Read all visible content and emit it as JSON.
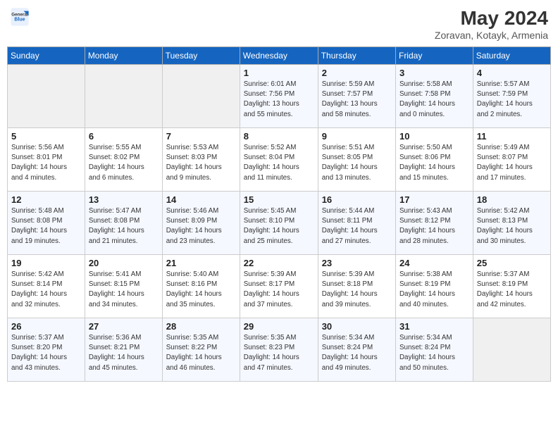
{
  "header": {
    "logo_line1": "General",
    "logo_line2": "Blue",
    "month": "May 2024",
    "location": "Zoravan, Kotayk, Armenia"
  },
  "days_of_week": [
    "Sunday",
    "Monday",
    "Tuesday",
    "Wednesday",
    "Thursday",
    "Friday",
    "Saturday"
  ],
  "weeks": [
    [
      {
        "day": "",
        "info": []
      },
      {
        "day": "",
        "info": []
      },
      {
        "day": "",
        "info": []
      },
      {
        "day": "1",
        "info": [
          "Sunrise: 6:01 AM",
          "Sunset: 7:56 PM",
          "Daylight: 13 hours",
          "and 55 minutes."
        ]
      },
      {
        "day": "2",
        "info": [
          "Sunrise: 5:59 AM",
          "Sunset: 7:57 PM",
          "Daylight: 13 hours",
          "and 58 minutes."
        ]
      },
      {
        "day": "3",
        "info": [
          "Sunrise: 5:58 AM",
          "Sunset: 7:58 PM",
          "Daylight: 14 hours",
          "and 0 minutes."
        ]
      },
      {
        "day": "4",
        "info": [
          "Sunrise: 5:57 AM",
          "Sunset: 7:59 PM",
          "Daylight: 14 hours",
          "and 2 minutes."
        ]
      }
    ],
    [
      {
        "day": "5",
        "info": [
          "Sunrise: 5:56 AM",
          "Sunset: 8:01 PM",
          "Daylight: 14 hours",
          "and 4 minutes."
        ]
      },
      {
        "day": "6",
        "info": [
          "Sunrise: 5:55 AM",
          "Sunset: 8:02 PM",
          "Daylight: 14 hours",
          "and 6 minutes."
        ]
      },
      {
        "day": "7",
        "info": [
          "Sunrise: 5:53 AM",
          "Sunset: 8:03 PM",
          "Daylight: 14 hours",
          "and 9 minutes."
        ]
      },
      {
        "day": "8",
        "info": [
          "Sunrise: 5:52 AM",
          "Sunset: 8:04 PM",
          "Daylight: 14 hours",
          "and 11 minutes."
        ]
      },
      {
        "day": "9",
        "info": [
          "Sunrise: 5:51 AM",
          "Sunset: 8:05 PM",
          "Daylight: 14 hours",
          "and 13 minutes."
        ]
      },
      {
        "day": "10",
        "info": [
          "Sunrise: 5:50 AM",
          "Sunset: 8:06 PM",
          "Daylight: 14 hours",
          "and 15 minutes."
        ]
      },
      {
        "day": "11",
        "info": [
          "Sunrise: 5:49 AM",
          "Sunset: 8:07 PM",
          "Daylight: 14 hours",
          "and 17 minutes."
        ]
      }
    ],
    [
      {
        "day": "12",
        "info": [
          "Sunrise: 5:48 AM",
          "Sunset: 8:08 PM",
          "Daylight: 14 hours",
          "and 19 minutes."
        ]
      },
      {
        "day": "13",
        "info": [
          "Sunrise: 5:47 AM",
          "Sunset: 8:08 PM",
          "Daylight: 14 hours",
          "and 21 minutes."
        ]
      },
      {
        "day": "14",
        "info": [
          "Sunrise: 5:46 AM",
          "Sunset: 8:09 PM",
          "Daylight: 14 hours",
          "and 23 minutes."
        ]
      },
      {
        "day": "15",
        "info": [
          "Sunrise: 5:45 AM",
          "Sunset: 8:10 PM",
          "Daylight: 14 hours",
          "and 25 minutes."
        ]
      },
      {
        "day": "16",
        "info": [
          "Sunrise: 5:44 AM",
          "Sunset: 8:11 PM",
          "Daylight: 14 hours",
          "and 27 minutes."
        ]
      },
      {
        "day": "17",
        "info": [
          "Sunrise: 5:43 AM",
          "Sunset: 8:12 PM",
          "Daylight: 14 hours",
          "and 28 minutes."
        ]
      },
      {
        "day": "18",
        "info": [
          "Sunrise: 5:42 AM",
          "Sunset: 8:13 PM",
          "Daylight: 14 hours",
          "and 30 minutes."
        ]
      }
    ],
    [
      {
        "day": "19",
        "info": [
          "Sunrise: 5:42 AM",
          "Sunset: 8:14 PM",
          "Daylight: 14 hours",
          "and 32 minutes."
        ]
      },
      {
        "day": "20",
        "info": [
          "Sunrise: 5:41 AM",
          "Sunset: 8:15 PM",
          "Daylight: 14 hours",
          "and 34 minutes."
        ]
      },
      {
        "day": "21",
        "info": [
          "Sunrise: 5:40 AM",
          "Sunset: 8:16 PM",
          "Daylight: 14 hours",
          "and 35 minutes."
        ]
      },
      {
        "day": "22",
        "info": [
          "Sunrise: 5:39 AM",
          "Sunset: 8:17 PM",
          "Daylight: 14 hours",
          "and 37 minutes."
        ]
      },
      {
        "day": "23",
        "info": [
          "Sunrise: 5:39 AM",
          "Sunset: 8:18 PM",
          "Daylight: 14 hours",
          "and 39 minutes."
        ]
      },
      {
        "day": "24",
        "info": [
          "Sunrise: 5:38 AM",
          "Sunset: 8:19 PM",
          "Daylight: 14 hours",
          "and 40 minutes."
        ]
      },
      {
        "day": "25",
        "info": [
          "Sunrise: 5:37 AM",
          "Sunset: 8:19 PM",
          "Daylight: 14 hours",
          "and 42 minutes."
        ]
      }
    ],
    [
      {
        "day": "26",
        "info": [
          "Sunrise: 5:37 AM",
          "Sunset: 8:20 PM",
          "Daylight: 14 hours",
          "and 43 minutes."
        ]
      },
      {
        "day": "27",
        "info": [
          "Sunrise: 5:36 AM",
          "Sunset: 8:21 PM",
          "Daylight: 14 hours",
          "and 45 minutes."
        ]
      },
      {
        "day": "28",
        "info": [
          "Sunrise: 5:35 AM",
          "Sunset: 8:22 PM",
          "Daylight: 14 hours",
          "and 46 minutes."
        ]
      },
      {
        "day": "29",
        "info": [
          "Sunrise: 5:35 AM",
          "Sunset: 8:23 PM",
          "Daylight: 14 hours",
          "and 47 minutes."
        ]
      },
      {
        "day": "30",
        "info": [
          "Sunrise: 5:34 AM",
          "Sunset: 8:24 PM",
          "Daylight: 14 hours",
          "and 49 minutes."
        ]
      },
      {
        "day": "31",
        "info": [
          "Sunrise: 5:34 AM",
          "Sunset: 8:24 PM",
          "Daylight: 14 hours",
          "and 50 minutes."
        ]
      },
      {
        "day": "",
        "info": []
      }
    ]
  ]
}
